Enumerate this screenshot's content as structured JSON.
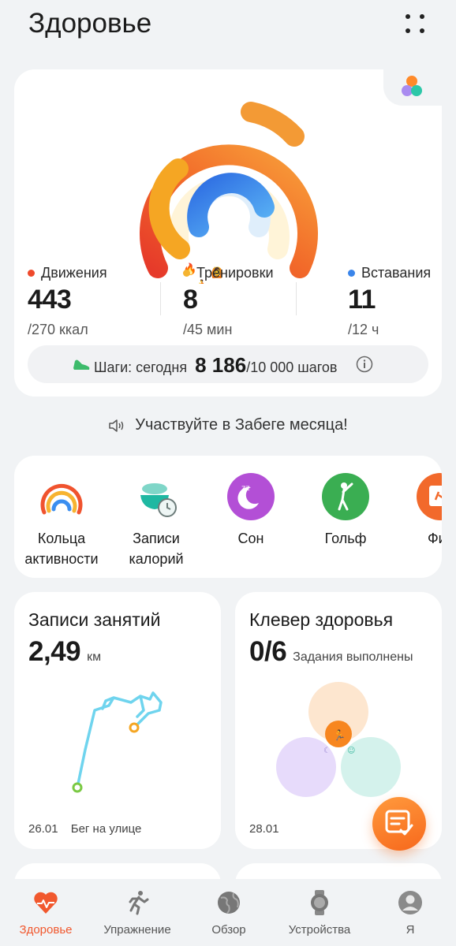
{
  "header": {
    "title": "Здоровье",
    "more_icon": "more-dots-icon"
  },
  "activity": {
    "move": {
      "label": "Движения",
      "value": "443",
      "goal": "/270 ккал",
      "color": "#ef4a2c"
    },
    "workout": {
      "label": "Тренировки",
      "value": "8",
      "goal": "/45 мин",
      "color": "#f5b431"
    },
    "stand": {
      "label": "Вставания",
      "value": "11",
      "goal": "/12 ч",
      "color": "#3a85ea"
    },
    "steps": {
      "label": "Шаги: сегодня",
      "value": "8 186",
      "goal": "/10 000 шагов"
    }
  },
  "promo": {
    "text": "Участвуйте в Забеге месяца!"
  },
  "shortcuts": [
    {
      "label": "Кольца активности",
      "icon": "activity-rings-icon"
    },
    {
      "label": "Записи калорий",
      "icon": "calorie-bowl-icon"
    },
    {
      "label": "Сон",
      "icon": "sleep-moon-icon"
    },
    {
      "label": "Гольф",
      "icon": "golf-icon"
    },
    {
      "label": "Фит",
      "icon": "fitness-plan-icon"
    }
  ],
  "workout_card": {
    "title": "Записи занятий",
    "value": "2,49",
    "unit": "км",
    "date": "26.01",
    "type": "Бег на улице"
  },
  "clover_card": {
    "title": "Клевер здоровья",
    "value": "0/6",
    "caption": "Задания выполнены",
    "date": "28.01"
  },
  "tabs": [
    {
      "label": "Здоровье",
      "icon": "heart-pulse-icon",
      "active": true
    },
    {
      "label": "Упражнение",
      "icon": "running-person-icon",
      "active": false
    },
    {
      "label": "Обзор",
      "icon": "globe-icon",
      "active": false
    },
    {
      "label": "Устройства",
      "icon": "watch-icon",
      "active": false
    },
    {
      "label": "Я",
      "icon": "user-avatar-icon",
      "active": false
    }
  ],
  "colors": {
    "accent": "#f1582e",
    "orange": "#f7681c",
    "background": "#f1f3f5"
  }
}
